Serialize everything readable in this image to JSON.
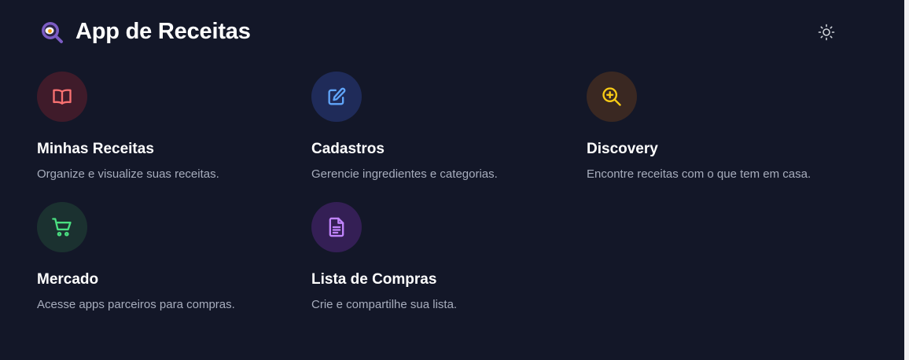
{
  "app": {
    "title": "App de Receitas",
    "logo_icon": "magnifier-egg-icon",
    "theme_toggle_icon": "sun-icon"
  },
  "colors": {
    "background": "#131728",
    "red": "#f87171",
    "blue": "#60a5fa",
    "amber": "#facc15",
    "green": "#4ade80",
    "purple": "#c084fc"
  },
  "cards": [
    {
      "title": "Minhas Receitas",
      "description": "Organize e visualize suas receitas.",
      "icon": "book-open-icon"
    },
    {
      "title": "Cadastros",
      "description": "Gerencie ingredientes e categorias.",
      "icon": "edit-icon"
    },
    {
      "title": "Discovery",
      "description": "Encontre receitas com o que tem em casa.",
      "icon": "zoom-in-icon"
    },
    {
      "title": "Mercado",
      "description": "Acesse apps parceiros para compras.",
      "icon": "shopping-cart-icon"
    },
    {
      "title": "Lista de Compras",
      "description": "Crie e compartilhe sua lista.",
      "icon": "document-text-icon"
    }
  ]
}
